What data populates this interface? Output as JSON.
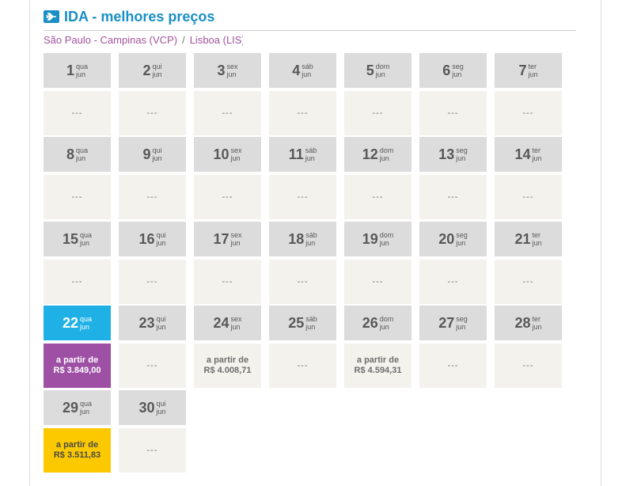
{
  "header": {
    "title": "IDA - melhores preços"
  },
  "route": {
    "origin": "São Paulo - Campinas (VCP)",
    "separator": "/",
    "destination": "Lisboa (LIS)"
  },
  "days": [
    {
      "day": "1",
      "weekday": "qua",
      "month": "jun",
      "price_label": "",
      "price": "---"
    },
    {
      "day": "2",
      "weekday": "qui",
      "month": "jun",
      "price_label": "",
      "price": "---"
    },
    {
      "day": "3",
      "weekday": "sex",
      "month": "jun",
      "price_label": "",
      "price": "---"
    },
    {
      "day": "4",
      "weekday": "sáb",
      "month": "jun",
      "price_label": "",
      "price": "---"
    },
    {
      "day": "5",
      "weekday": "dom",
      "month": "jun",
      "price_label": "",
      "price": "---"
    },
    {
      "day": "6",
      "weekday": "seg",
      "month": "jun",
      "price_label": "",
      "price": "---"
    },
    {
      "day": "7",
      "weekday": "ter",
      "month": "jun",
      "price_label": "",
      "price": "---"
    },
    {
      "day": "8",
      "weekday": "qua",
      "month": "jun",
      "price_label": "",
      "price": "---"
    },
    {
      "day": "9",
      "weekday": "qui",
      "month": "jun",
      "price_label": "",
      "price": "---"
    },
    {
      "day": "10",
      "weekday": "sex",
      "month": "jun",
      "price_label": "",
      "price": "---"
    },
    {
      "day": "11",
      "weekday": "sáb",
      "month": "jun",
      "price_label": "",
      "price": "---"
    },
    {
      "day": "12",
      "weekday": "dom",
      "month": "jun",
      "price_label": "",
      "price": "---"
    },
    {
      "day": "13",
      "weekday": "seg",
      "month": "jun",
      "price_label": "",
      "price": "---"
    },
    {
      "day": "14",
      "weekday": "ter",
      "month": "jun",
      "price_label": "",
      "price": "---"
    },
    {
      "day": "15",
      "weekday": "qua",
      "month": "jun",
      "price_label": "",
      "price": "---"
    },
    {
      "day": "16",
      "weekday": "qui",
      "month": "jun",
      "price_label": "",
      "price": "---"
    },
    {
      "day": "17",
      "weekday": "sex",
      "month": "jun",
      "price_label": "",
      "price": "---"
    },
    {
      "day": "18",
      "weekday": "sáb",
      "month": "jun",
      "price_label": "",
      "price": "---"
    },
    {
      "day": "19",
      "weekday": "dom",
      "month": "jun",
      "price_label": "",
      "price": "---"
    },
    {
      "day": "20",
      "weekday": "seg",
      "month": "jun",
      "price_label": "",
      "price": "---"
    },
    {
      "day": "21",
      "weekday": "ter",
      "month": "jun",
      "price_label": "",
      "price": "---"
    },
    {
      "day": "22",
      "weekday": "qua",
      "month": "jun",
      "price_label": "a partir de",
      "price": "R$ 3.849,00",
      "selected": true,
      "highlight": "purple"
    },
    {
      "day": "23",
      "weekday": "qui",
      "month": "jun",
      "price_label": "",
      "price": "---"
    },
    {
      "day": "24",
      "weekday": "sex",
      "month": "jun",
      "price_label": "a partir de",
      "price": "R$ 4.008,71"
    },
    {
      "day": "25",
      "weekday": "sáb",
      "month": "jun",
      "price_label": "",
      "price": "---"
    },
    {
      "day": "26",
      "weekday": "dom",
      "month": "jun",
      "price_label": "a partir de",
      "price": "R$ 4.594,31"
    },
    {
      "day": "27",
      "weekday": "seg",
      "month": "jun",
      "price_label": "",
      "price": "---"
    },
    {
      "day": "28",
      "weekday": "ter",
      "month": "jun",
      "price_label": "",
      "price": "---"
    },
    {
      "day": "29",
      "weekday": "qua",
      "month": "jun",
      "price_label": "a partir de",
      "price": "R$ 3.511,83",
      "highlight": "yellow"
    },
    {
      "day": "30",
      "weekday": "qui",
      "month": "jun",
      "price_label": "",
      "price": "---"
    }
  ],
  "colors": {
    "title": "#1a8fc5",
    "route": "#a0539c",
    "selected_date": "#1fb1e6",
    "best_price": "#9d50a4",
    "lowest_price": "#fcc900"
  }
}
